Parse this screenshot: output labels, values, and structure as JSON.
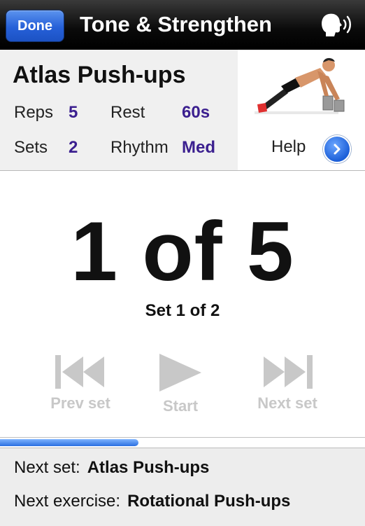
{
  "nav": {
    "done_label": "Done",
    "title": "Tone & Strengthen",
    "voice_icon": "speaking-head-icon"
  },
  "exercise": {
    "name": "Atlas Push-ups",
    "reps_label": "Reps",
    "reps_value": "5",
    "rest_label": "Rest",
    "rest_value": "60s",
    "sets_label": "Sets",
    "sets_value": "2",
    "rhythm_label": "Rhythm",
    "rhythm_value": "Med",
    "help_label": "Help"
  },
  "counter": {
    "text": "1 of 5",
    "set_text": "Set 1 of 2"
  },
  "controls": {
    "prev_label": "Prev set",
    "start_label": "Start",
    "next_label": "Next set"
  },
  "progress": {
    "fraction": 0.38
  },
  "upcoming": {
    "next_set_label": "Next set:",
    "next_set_value": "Atlas Push-ups",
    "next_exercise_label": "Next exercise:",
    "next_exercise_value": "Rotational Push-ups"
  },
  "colors": {
    "accent_value": "#3b1f8f",
    "done_blue": "#2660d8",
    "disabled_control": "#c8c8c8"
  }
}
